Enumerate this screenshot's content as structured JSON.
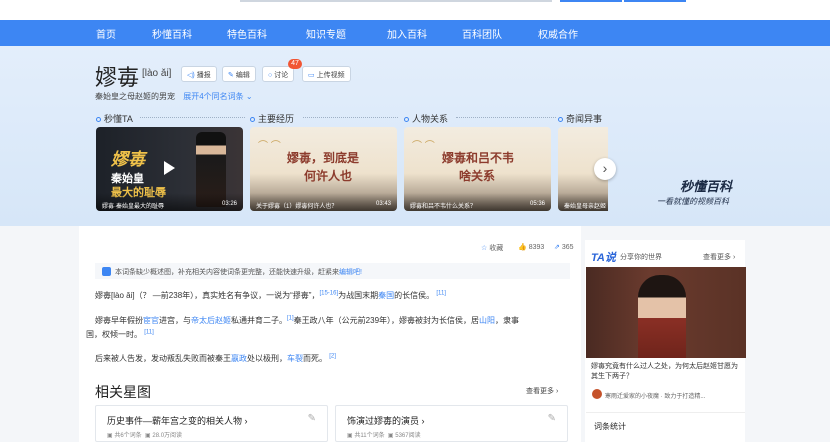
{
  "nav": {
    "items": [
      "首页",
      "秒懂百科",
      "特色百科",
      "知识专题",
      "加入百科",
      "百科团队",
      "权威合作"
    ]
  },
  "entry": {
    "title": "嫪毐",
    "pinyin": "[lào ǎi]",
    "actions": {
      "play": "播报",
      "edit": "编辑",
      "discuss": "讨论",
      "discuss_count": "47",
      "upload": "上传视频"
    },
    "subtitle": "秦始皇之母赵姬的男宠",
    "expand": "展开4个同名词条"
  },
  "sections": [
    "秒懂TA",
    "主要经历",
    "人物关系",
    "奇闻异事"
  ],
  "cards": [
    {
      "big1": "嫪毐",
      "big2": "秦始皇",
      "big3": "最大的耻辱",
      "caption": "嫪毐·秦始皇最大的耻辱",
      "duration": "03:26"
    },
    {
      "big1": "嫪毐，到底是",
      "big2": "何许人也",
      "caption": "关于嫪毐（1）嫪毐何许人也？",
      "duration": "03:43"
    },
    {
      "big1": "嫪毐和吕不韦",
      "big2": "啥关系",
      "caption": "嫪毐和吕不韦什么关系？",
      "duration": "05:36"
    },
    {
      "caption": "秦始皇母亲赵姬",
      "duration": ""
    }
  ],
  "brand": {
    "name": "秒懂百科",
    "slogan": "一看就懂的视频百科"
  },
  "stats": {
    "collect": "收藏",
    "likes": "8393",
    "shares": "365"
  },
  "notice": {
    "text": "本词条缺少概述图，补充相关内容使词条更完整，还能快速升级，赶紧来",
    "link": "编辑吧!"
  },
  "paragraphs": [
    {
      "a": "嫪毐[lào ǎi]（？ —前238年），真实姓名有争议，一说为“摎毐”，",
      "sup1": "[15-16]",
      "b": "为战国末期",
      "link1": "秦国",
      "c": "的长信侯。",
      "sup2": "[11]"
    },
    {
      "a": "嫪毐早年假扮",
      "link1": "宦官",
      "b": "进宫，与",
      "link2": "帝太后赵姬",
      "c": "私通并育二子。",
      "sup1": "[1]",
      "d": "秦王政八年（公元前239年），嫪毐被封为长信侯，居",
      "link3": "山阳",
      "e": "，隶事"
    },
    {
      "a": "国，权倾一时。",
      "sup1": "[11]"
    },
    {
      "a": "后来被人告发，发动叛乱失败而被秦王",
      "link1": "嬴政",
      "b": "处以极刑，",
      "link2": "车裂",
      "c": "而死。",
      "sup1": "[2]"
    }
  ],
  "related": {
    "title": "相关星图",
    "more": "查看更多",
    "items": [
      {
        "title": "历史事件—蕲年宫之变的相关人物",
        "count": "共6个词条",
        "views": "28.0万阅读"
      },
      {
        "title": "饰演过嫪毐的演员",
        "count": "共11个词条",
        "views": "5367阅读"
      }
    ]
  },
  "ta": {
    "logo": "TA说",
    "sub": "分享你的世界",
    "more": "查看更多",
    "caption": "嫪毐究竟有什么过人之处，为何太后赵姬甘愿为其生下两子？",
    "author": "寒雨迁爱家的小夜魔 · 致力于打造精..."
  },
  "word_stats": {
    "title": "词条统计"
  },
  "colors": {
    "nav": "#3d86f3",
    "link": "#3d86f3",
    "badge": "#f15533"
  }
}
